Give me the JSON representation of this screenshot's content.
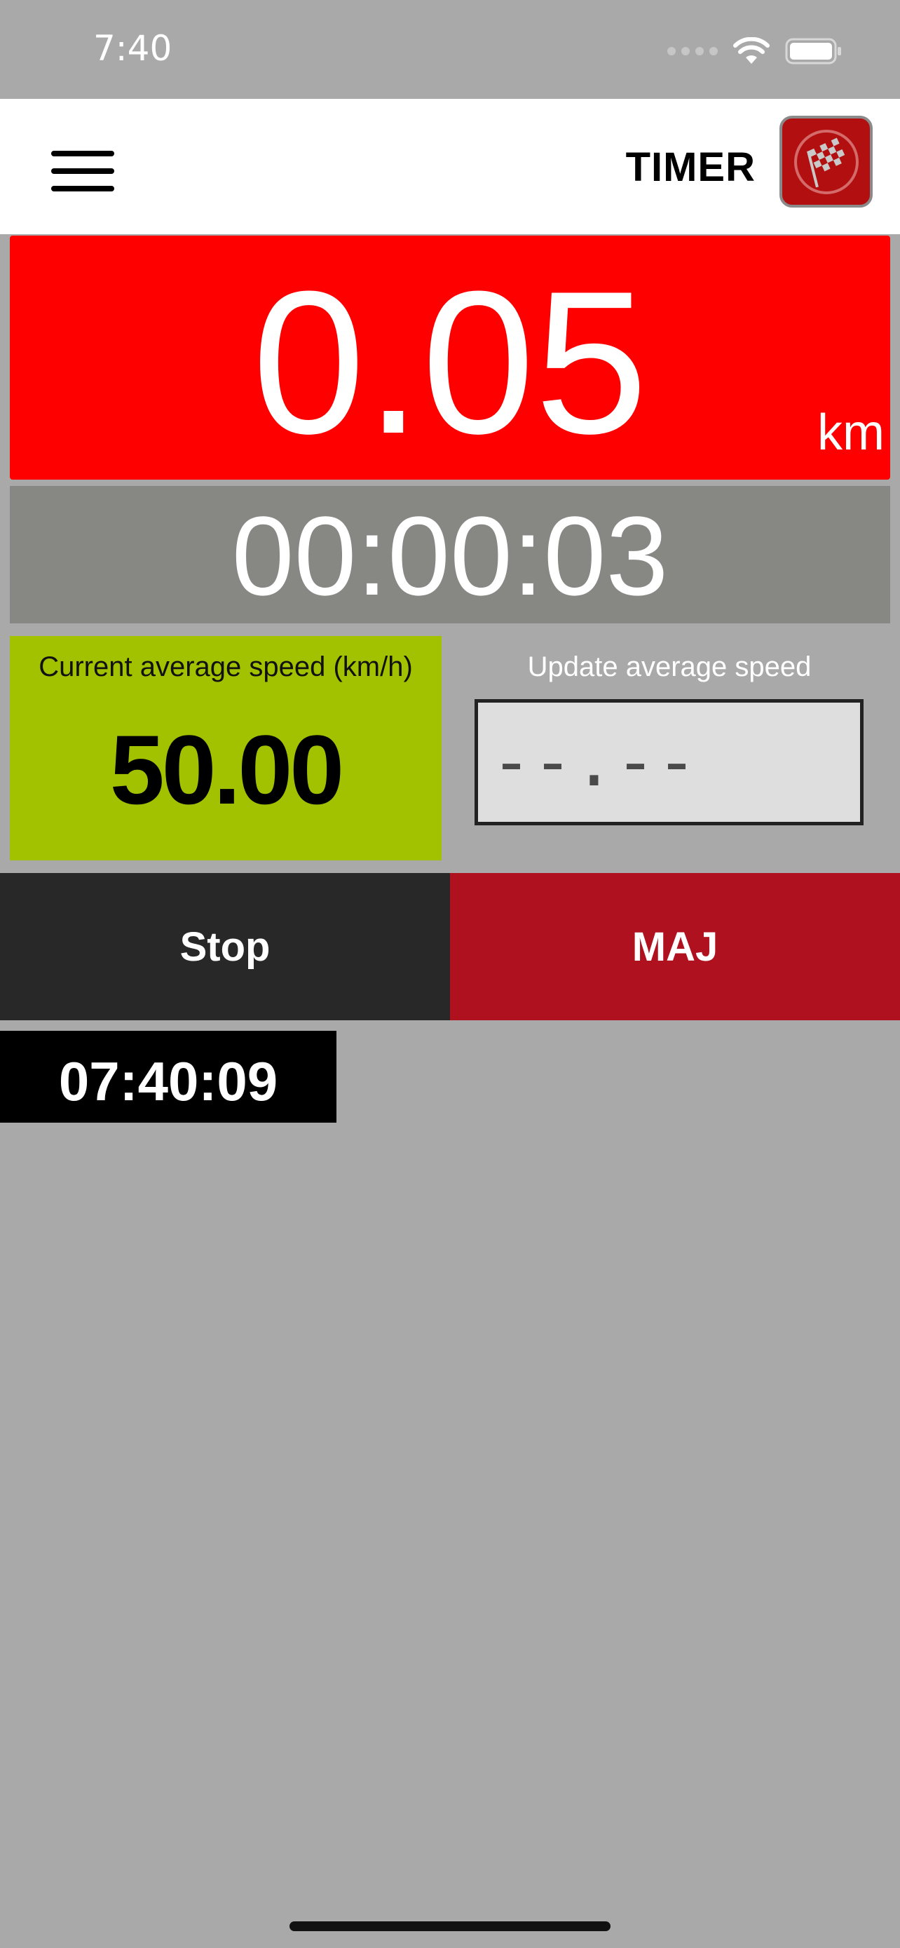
{
  "status_bar": {
    "time": "7:40"
  },
  "header": {
    "title": "TIMER"
  },
  "distance": {
    "value": "0.05",
    "unit": "km"
  },
  "elapsed_time": "00:00:03",
  "current_speed": {
    "label": "Current average speed (km/h)",
    "value": "50.00"
  },
  "update_speed": {
    "label": "Update average speed",
    "placeholder": "--.--"
  },
  "buttons": {
    "stop_label": "Stop",
    "maj_label": "MAJ"
  },
  "clock": "07:40:09",
  "colors": {
    "distance_bg": "#ff0000",
    "time_bg": "#878784",
    "speed_bg": "#a2c200",
    "stop_bg": "#282828",
    "maj_bg": "#b0111f",
    "page_bg": "#a9a9a9"
  },
  "icons": {
    "menu": "hamburger-menu-icon",
    "app": "checkered-flag-icon",
    "wifi": "wifi-icon",
    "battery": "battery-icon",
    "signal": "cellular-signal-icon"
  }
}
